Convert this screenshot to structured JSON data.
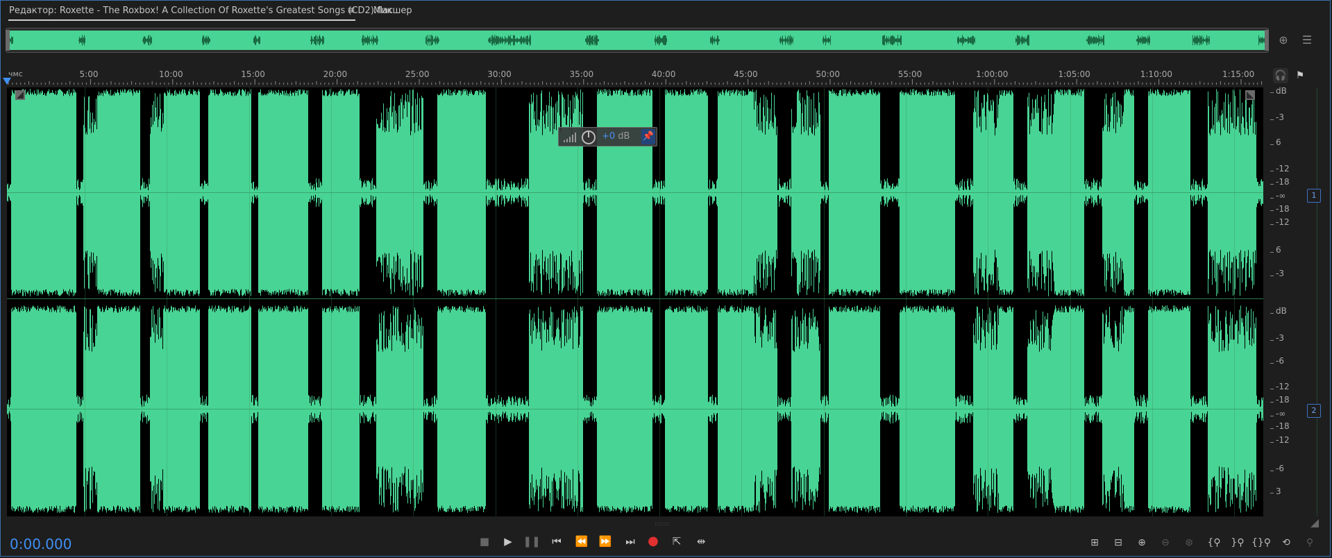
{
  "tabs": {
    "editor_title": "Редактор: Roxette - The Roxbox! A Collection Of Roxette's Greatest Songs (CD2).flac",
    "editor_menu_icon": "≡",
    "mixer": "Микшер"
  },
  "ruler": {
    "units": "чмс",
    "labels": [
      "5:00",
      "10:00",
      "15:00",
      "20:00",
      "25:00",
      "30:00",
      "35:00",
      "40:00",
      "45:00",
      "50:00",
      "55:00",
      "1:00:00",
      "1:05:00",
      "1:10:00",
      "1:15:00"
    ]
  },
  "hud": {
    "plus": "+0",
    "unit": " dB",
    "icons": [
      "level-meter-icon",
      "knob-icon",
      "pin-icon"
    ]
  },
  "db_scale": {
    "top_label": "dB",
    "ch1": [
      "dB",
      "-3",
      "6",
      "-12",
      "-18",
      "-∞",
      "-18",
      "-12",
      "6",
      "-3"
    ],
    "ch2": [
      "dB",
      "-3",
      "-6",
      "-12",
      "-18",
      "-∞",
      "-18",
      "-12",
      "-6",
      "3"
    ]
  },
  "channels": [
    "1",
    "2"
  ],
  "timecode": "0:00.000",
  "transport_icons": [
    "stop-icon",
    "play-icon",
    "pause-icon",
    "skip-to-start-icon",
    "rewind-icon",
    "fast-forward-icon",
    "skip-to-end-icon",
    "record-icon",
    "loop-playback-icon",
    "skip-selection-icon"
  ],
  "zoom_icons": [
    "zoom-in-amplitude-icon",
    "zoom-out-amplitude-icon",
    "zoom-in-time-icon",
    "zoom-out-time-icon",
    "zoom-selection-icon",
    "zoom-in-left-icon",
    "zoom-in-right-icon",
    "zoom-out-full-icon",
    "zoom-to-playhead-icon",
    "zoom-reset-icon"
  ],
  "colors": {
    "waveform": "#48d494",
    "accent": "#3f8ff4",
    "record": "#e03030"
  }
}
